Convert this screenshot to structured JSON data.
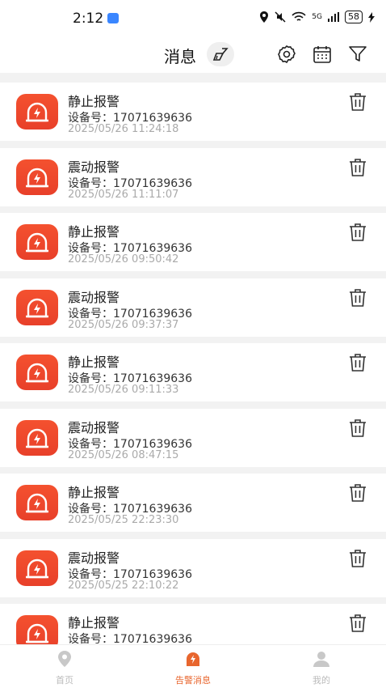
{
  "status": {
    "time": "2:12",
    "network": "5G",
    "battery": "58"
  },
  "header": {
    "title": "消息"
  },
  "messages": [
    {
      "title": "静止报警",
      "device": "设备号：17071639636",
      "time": "2025/05/26 11:24:18"
    },
    {
      "title": "震动报警",
      "device": "设备号：17071639636",
      "time": "2025/05/26 11:11:07"
    },
    {
      "title": "静止报警",
      "device": "设备号：17071639636",
      "time": "2025/05/26 09:50:42"
    },
    {
      "title": "震动报警",
      "device": "设备号：17071639636",
      "time": "2025/05/26 09:37:37"
    },
    {
      "title": "静止报警",
      "device": "设备号：17071639636",
      "time": "2025/05/26 09:11:33"
    },
    {
      "title": "震动报警",
      "device": "设备号：17071639636",
      "time": "2025/05/26 08:47:15"
    },
    {
      "title": "静止报警",
      "device": "设备号：17071639636",
      "time": "2025/05/25 22:23:30"
    },
    {
      "title": "震动报警",
      "device": "设备号：17071639636",
      "time": "2025/05/25 22:10:22"
    },
    {
      "title": "静止报警",
      "device": "设备号：17071639636",
      "time": ""
    }
  ],
  "tabs": [
    {
      "label": "首页",
      "icon": "location-pin-icon",
      "active": false
    },
    {
      "label": "告警消息",
      "icon": "alarm-icon",
      "active": true
    },
    {
      "label": "我的",
      "icon": "user-icon",
      "active": false
    }
  ],
  "colors": {
    "accent": "#f2522e",
    "tab_active": "#e8662e",
    "tab_inactive": "#bbbbbb"
  }
}
